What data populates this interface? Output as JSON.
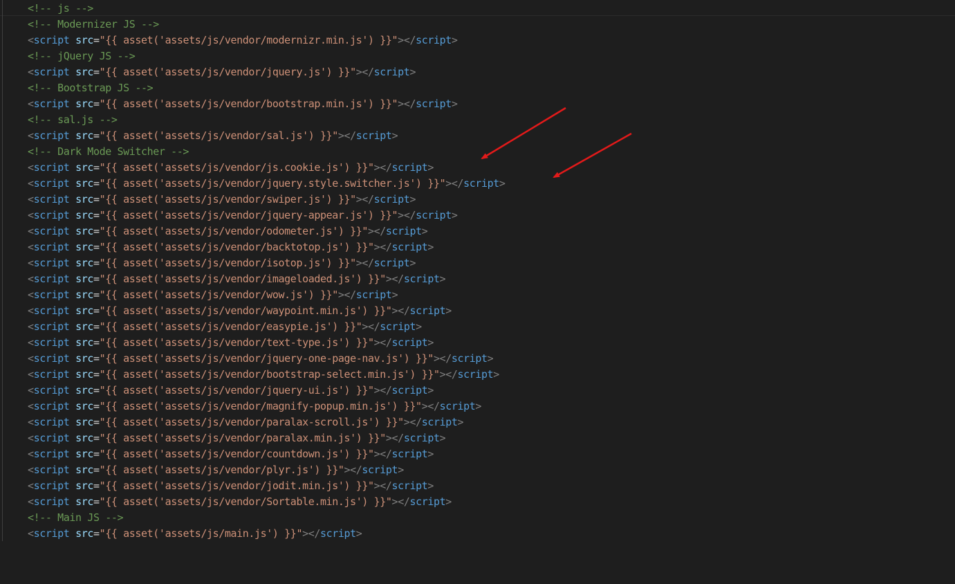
{
  "editor": {
    "colors": {
      "background": "#1e1e1e",
      "comment": "#6a9955",
      "punctuation": "#808080",
      "tag": "#569cd6",
      "attribute": "#9cdcfe",
      "string": "#ce9178",
      "annotation_arrow": "#e31a1a"
    },
    "tokens": {
      "open_tag": "<",
      "script_tag": "script",
      "attr_name": "src",
      "equals": "=",
      "close_open": ">",
      "end_tag_open": "</",
      "end_tag_close": ">"
    },
    "lines": [
      {
        "type": "comment",
        "text": "<!-- js -->"
      },
      {
        "type": "comment",
        "text": "<!-- Modernizer JS -->"
      },
      {
        "type": "script",
        "src": "\"{{ asset('assets/js/vendor/modernizr.min.js') }}\""
      },
      {
        "type": "comment",
        "text": "<!-- jQuery JS -->"
      },
      {
        "type": "script",
        "src": "\"{{ asset('assets/js/vendor/jquery.js') }}\""
      },
      {
        "type": "comment",
        "text": "<!-- Bootstrap JS -->"
      },
      {
        "type": "script",
        "src": "\"{{ asset('assets/js/vendor/bootstrap.min.js') }}\""
      },
      {
        "type": "comment",
        "text": "<!-- sal.js -->"
      },
      {
        "type": "script",
        "src": "\"{{ asset('assets/js/vendor/sal.js') }}\""
      },
      {
        "type": "comment",
        "text": "<!-- Dark Mode Switcher -->"
      },
      {
        "type": "script",
        "src": "\"{{ asset('assets/js/vendor/js.cookie.js') }}\""
      },
      {
        "type": "script",
        "src": "\"{{ asset('assets/js/vendor/jquery.style.switcher.js') }}\""
      },
      {
        "type": "script",
        "src": "\"{{ asset('assets/js/vendor/swiper.js') }}\""
      },
      {
        "type": "script",
        "src": "\"{{ asset('assets/js/vendor/jquery-appear.js') }}\""
      },
      {
        "type": "script",
        "src": "\"{{ asset('assets/js/vendor/odometer.js') }}\""
      },
      {
        "type": "script",
        "src": "\"{{ asset('assets/js/vendor/backtotop.js') }}\""
      },
      {
        "type": "script",
        "src": "\"{{ asset('assets/js/vendor/isotop.js') }}\""
      },
      {
        "type": "script",
        "src": "\"{{ asset('assets/js/vendor/imageloaded.js') }}\""
      },
      {
        "type": "script",
        "src": "\"{{ asset('assets/js/vendor/wow.js') }}\""
      },
      {
        "type": "script",
        "src": "\"{{ asset('assets/js/vendor/waypoint.min.js') }}\""
      },
      {
        "type": "script",
        "src": "\"{{ asset('assets/js/vendor/easypie.js') }}\""
      },
      {
        "type": "script",
        "src": "\"{{ asset('assets/js/vendor/text-type.js') }}\""
      },
      {
        "type": "script",
        "src": "\"{{ asset('assets/js/vendor/jquery-one-page-nav.js') }}\""
      },
      {
        "type": "script",
        "src": "\"{{ asset('assets/js/vendor/bootstrap-select.min.js') }}\""
      },
      {
        "type": "script",
        "src": "\"{{ asset('assets/js/vendor/jquery-ui.js') }}\""
      },
      {
        "type": "script",
        "src": "\"{{ asset('assets/js/vendor/magnify-popup.min.js') }}\""
      },
      {
        "type": "script",
        "src": "\"{{ asset('assets/js/vendor/paralax-scroll.js') }}\""
      },
      {
        "type": "script",
        "src": "\"{{ asset('assets/js/vendor/paralax.min.js') }}\""
      },
      {
        "type": "script",
        "src": "\"{{ asset('assets/js/vendor/countdown.js') }}\""
      },
      {
        "type": "script",
        "src": "\"{{ asset('assets/js/vendor/plyr.js') }}\""
      },
      {
        "type": "script",
        "src": "\"{{ asset('assets/js/vendor/jodit.min.js') }}\""
      },
      {
        "type": "script",
        "src": "\"{{ asset('assets/js/vendor/Sortable.min.js') }}\""
      },
      {
        "type": "comment",
        "text": "<!-- Main JS -->"
      },
      {
        "type": "script",
        "src": "\"{{ asset('assets/js/main.js') }}\""
      }
    ]
  }
}
